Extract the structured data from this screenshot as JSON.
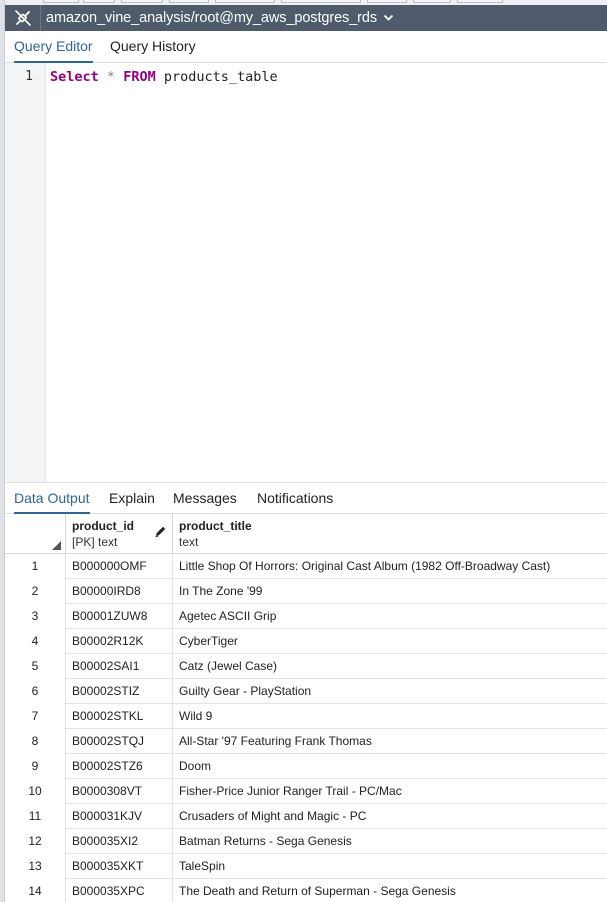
{
  "connection": {
    "title": "amazon_vine_analysis/root@my_aws_postgres_rds",
    "icon": "connection-plug-icon"
  },
  "editor_tabs": [
    {
      "label": "Query Editor",
      "active": true
    },
    {
      "label": "Query History",
      "active": false
    }
  ],
  "editor": {
    "line_number": "1",
    "code": {
      "kw1": "Select",
      "star": "*",
      "kw2": "FROM",
      "table": "products_table"
    }
  },
  "output_tabs": [
    {
      "label": "Data Output",
      "active": true
    },
    {
      "label": "Explain",
      "active": false
    },
    {
      "label": "Messages",
      "active": false
    },
    {
      "label": "Notifications",
      "active": false
    }
  ],
  "grid": {
    "columns": [
      {
        "name": "product_id",
        "type": "[PK] text"
      },
      {
        "name": "product_title",
        "type": "text"
      }
    ],
    "rows": [
      {
        "n": "1",
        "product_id": "B000000OMF",
        "product_title": "Little Shop Of Horrors: Original Cast Album (1982 Off-Broadway Cast)"
      },
      {
        "n": "2",
        "product_id": "B00000IRD8",
        "product_title": "In The Zone '99"
      },
      {
        "n": "3",
        "product_id": "B00001ZUW8",
        "product_title": "Agetec ASCII Grip"
      },
      {
        "n": "4",
        "product_id": "B00002R12K",
        "product_title": "CyberTiger"
      },
      {
        "n": "5",
        "product_id": "B00002SAI1",
        "product_title": "Catz (Jewel Case)"
      },
      {
        "n": "6",
        "product_id": "B00002STIZ",
        "product_title": "Guilty Gear - PlayStation"
      },
      {
        "n": "7",
        "product_id": "B00002STKL",
        "product_title": "Wild 9"
      },
      {
        "n": "8",
        "product_id": "B00002STQJ",
        "product_title": "All-Star '97 Featuring Frank Thomas"
      },
      {
        "n": "9",
        "product_id": "B00002STZ6",
        "product_title": "Doom"
      },
      {
        "n": "10",
        "product_id": "B0000308VT",
        "product_title": "Fisher-Price Junior Ranger Trail - PC/Mac"
      },
      {
        "n": "11",
        "product_id": "B000031KJV",
        "product_title": "Crusaders of Might and Magic - PC"
      },
      {
        "n": "12",
        "product_id": "B000035XI2",
        "product_title": "Batman Returns - Sega Genesis"
      },
      {
        "n": "13",
        "product_id": "B000035XKT",
        "product_title": "TaleSpin"
      },
      {
        "n": "14",
        "product_id": "B000035XPC",
        "product_title": "The Death and Return of Superman - Sega Genesis"
      }
    ]
  },
  "colors": {
    "connection_bar": "#4f5b6b",
    "active_tab": "#326690",
    "keyword": "#910082"
  }
}
